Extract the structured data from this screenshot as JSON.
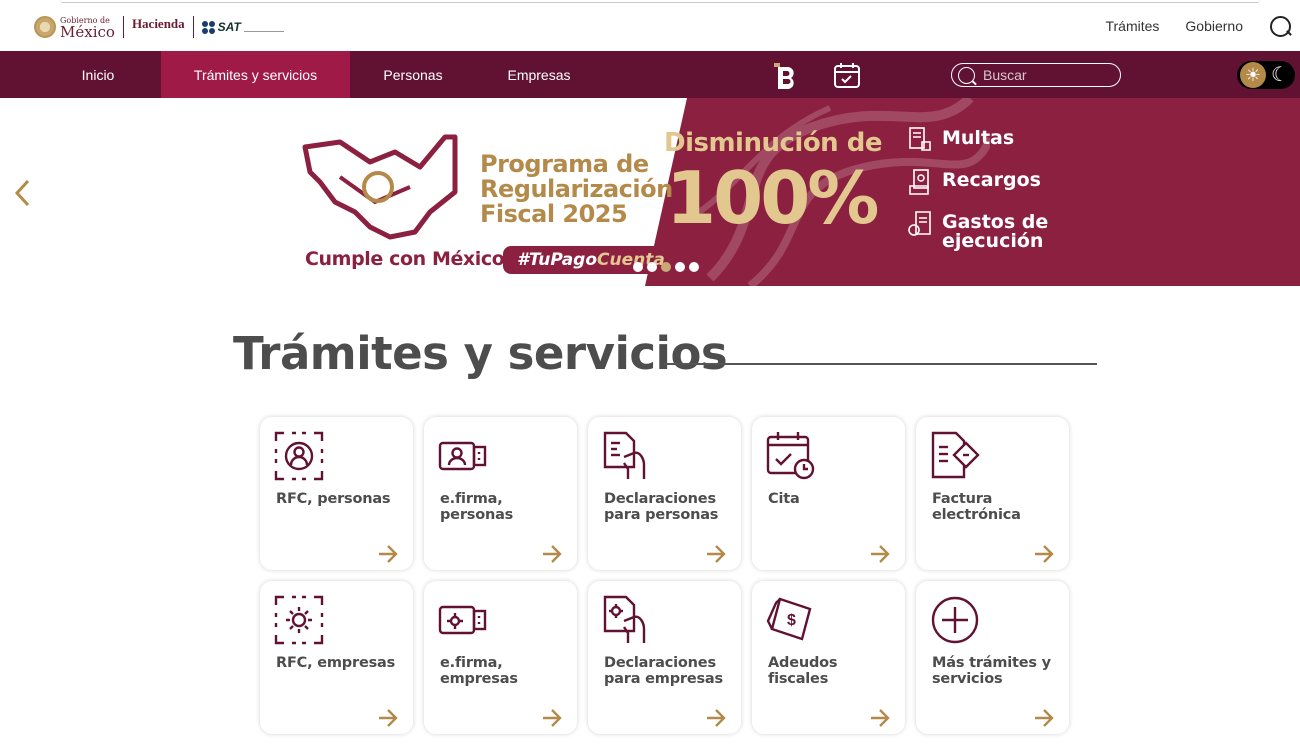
{
  "header": {
    "logo_gobierno_small": "Gobierno de",
    "logo_gobierno_big": "México",
    "logo_hacienda": "Hacienda",
    "logo_sat": "SAT",
    "links": [
      "Trámites",
      "Gobierno"
    ]
  },
  "nav": {
    "items": [
      "Inicio",
      "Trámites y servicios",
      "Personas",
      "Empresas"
    ],
    "active": "Trámites y servicios",
    "search_placeholder": "Buscar"
  },
  "banner": {
    "program_line1": "Programa de",
    "program_line2": "Regularización",
    "program_line3": "Fiscal 2025",
    "slogan": "Cumple con México",
    "hashtag_a": "#TuPago",
    "hashtag_b": "Cuenta",
    "disminucion": "Disminución de",
    "percent": "100%",
    "benefits": [
      "Multas",
      "Recargos",
      "Gastos de ejecución"
    ],
    "slide_count": 5,
    "active_slide": 3
  },
  "section": {
    "title": "Trámites y servicios"
  },
  "cards": [
    {
      "label": "RFC, personas",
      "icon": "rfc-person-icon"
    },
    {
      "label": "e.firma, personas",
      "icon": "efirma-person-icon"
    },
    {
      "label": "Declaraciones para personas",
      "icon": "declaration-person-icon"
    },
    {
      "label": "Cita",
      "icon": "calendar-clock-icon"
    },
    {
      "label": "Factura electrónica",
      "icon": "invoice-icon"
    },
    {
      "label": "RFC, empresas",
      "icon": "rfc-company-icon"
    },
    {
      "label": "e.firma, empresas",
      "icon": "efirma-company-icon"
    },
    {
      "label": "Declaraciones para empresas",
      "icon": "declaration-company-icon"
    },
    {
      "label": "Adeudos fiscales",
      "icon": "tax-debt-icon"
    },
    {
      "label": "Más trámites y servicios",
      "icon": "plus-circle-icon"
    }
  ],
  "colors": {
    "guinda": "#611232",
    "guinda_active": "#a01a48",
    "banner_red": "#8c2041",
    "gold": "#b48a4a",
    "light_gold": "#e2c78f"
  }
}
